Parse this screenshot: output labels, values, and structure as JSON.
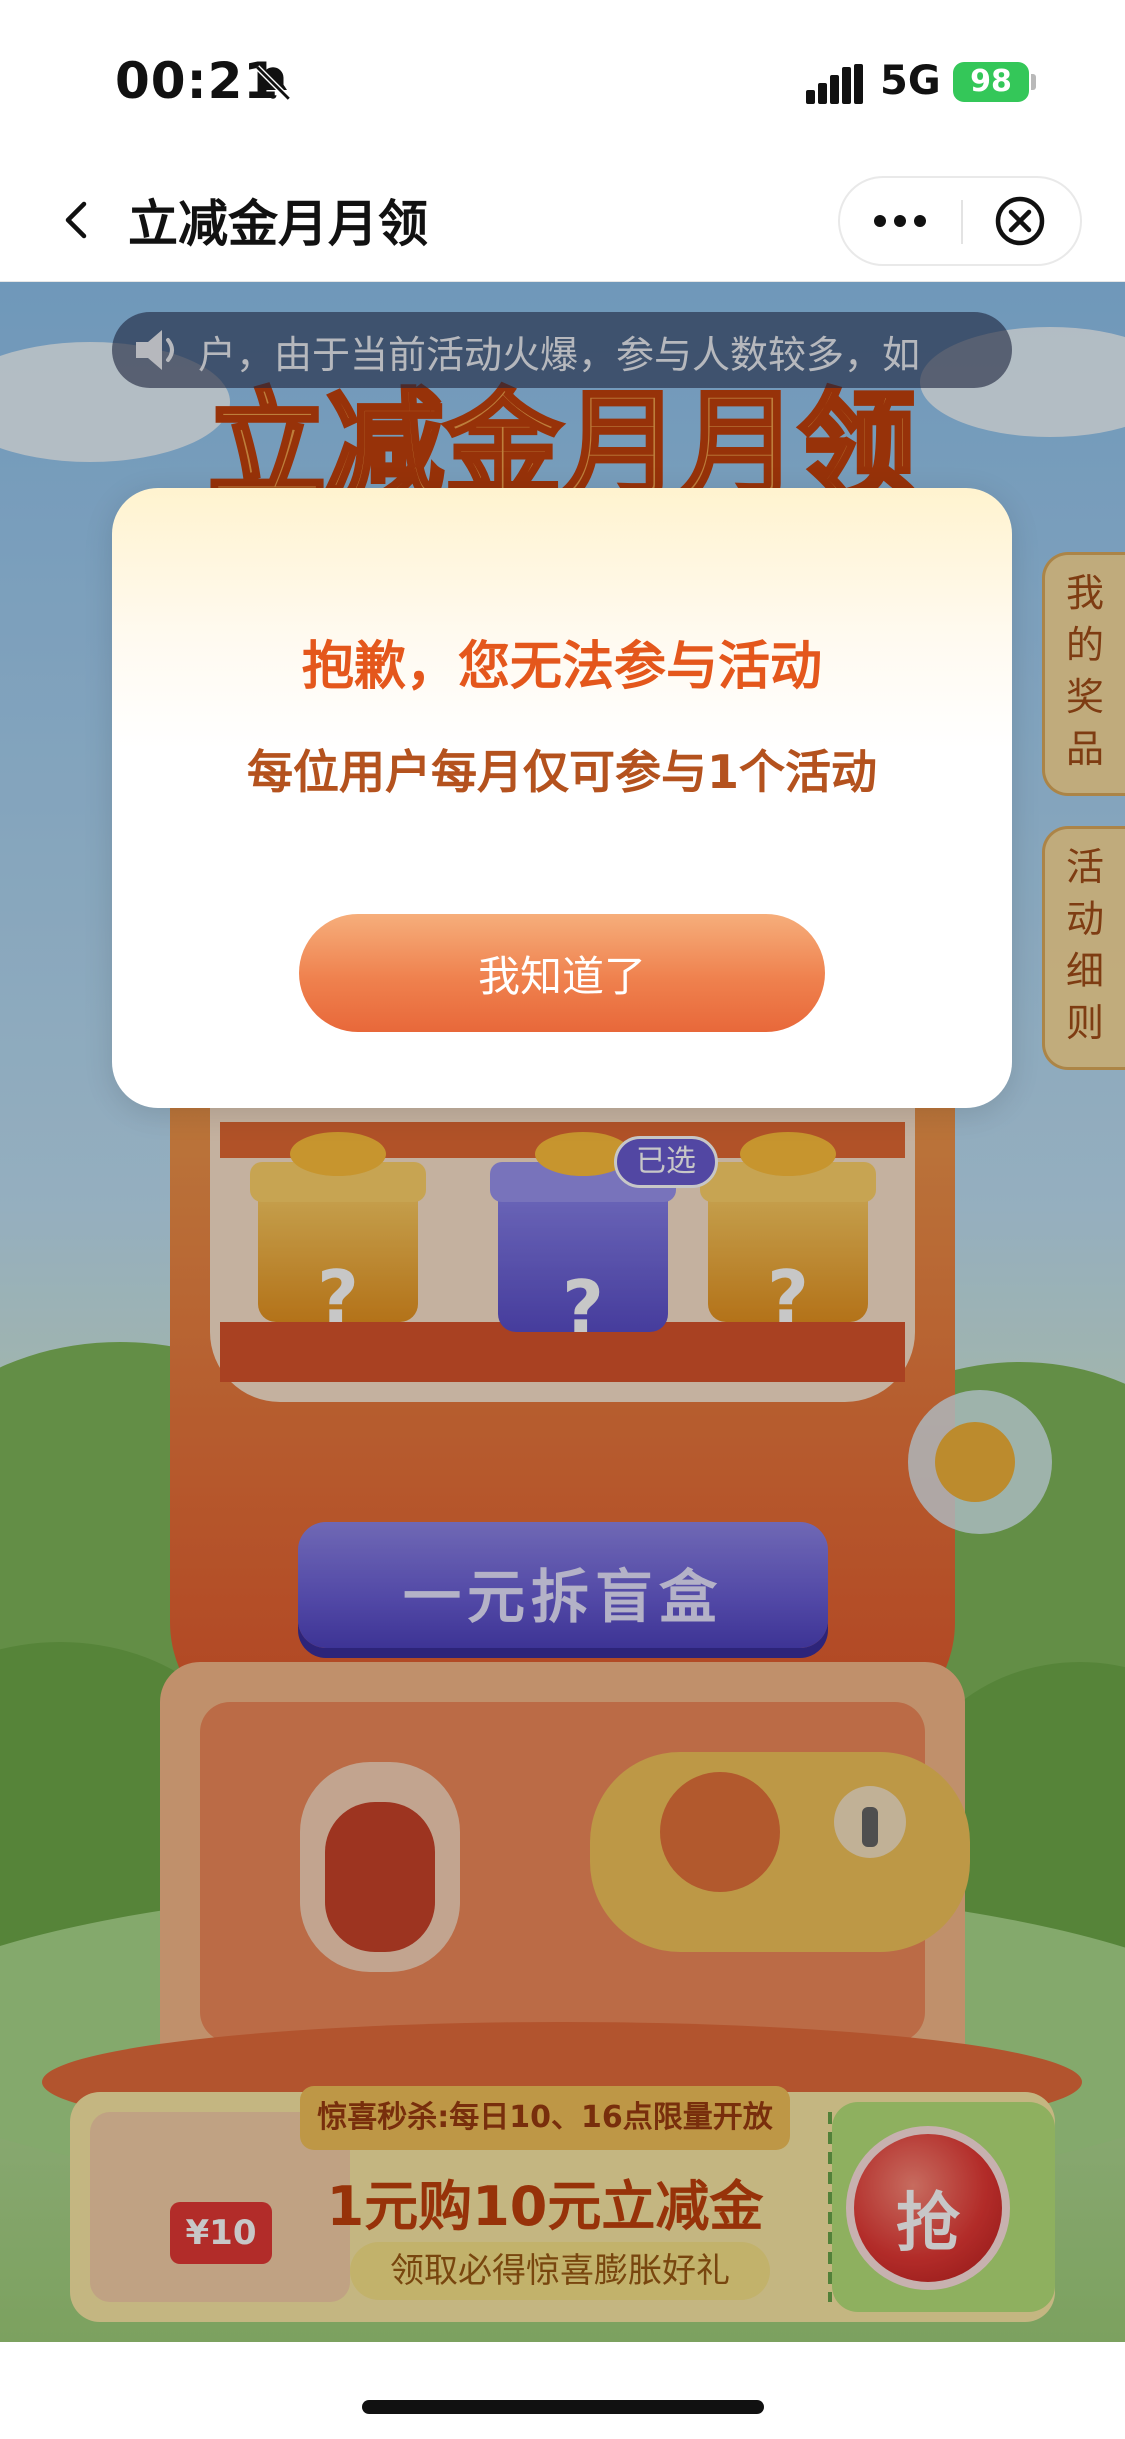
{
  "status_bar": {
    "time": "00:21",
    "network": "5G",
    "battery": "98",
    "icons": [
      "bell-off-icon",
      "signal-icon",
      "battery-charging-icon"
    ],
    "battery_color": "#34c759"
  },
  "nav": {
    "title": "立减金月月领",
    "icons": [
      "chevron-left-icon",
      "more-icon",
      "close-circle-icon"
    ]
  },
  "scene": {
    "notice_text": "户，由于当前活动火爆，参与人数较多，如",
    "banner_title": "立减金月月领",
    "side_tabs": [
      {
        "label": "我的奖品",
        "chars": [
          "我",
          "的",
          "奖",
          "品"
        ]
      },
      {
        "label": "活动细则",
        "chars": [
          "活",
          "动",
          "细",
          "则"
        ]
      }
    ],
    "selected_badge": "已选",
    "gift_marks": [
      "?",
      "?",
      "?"
    ],
    "open_button": "一元拆盲盒",
    "promo": {
      "flash_tag": "惊喜秒杀:每日10、16点限量开放",
      "title": "1元购10元立减金",
      "subtitle": "领取必得惊喜膨胀好礼",
      "grab_label": "抢",
      "voucher_amount": "¥10"
    }
  },
  "dialog": {
    "title": "抱歉，您无法参与活动",
    "message": "每位用户每月仅可参与1个活动",
    "confirm_label": "我知道了",
    "accent_color": "#e4571c",
    "button_color": "#ef814e"
  }
}
